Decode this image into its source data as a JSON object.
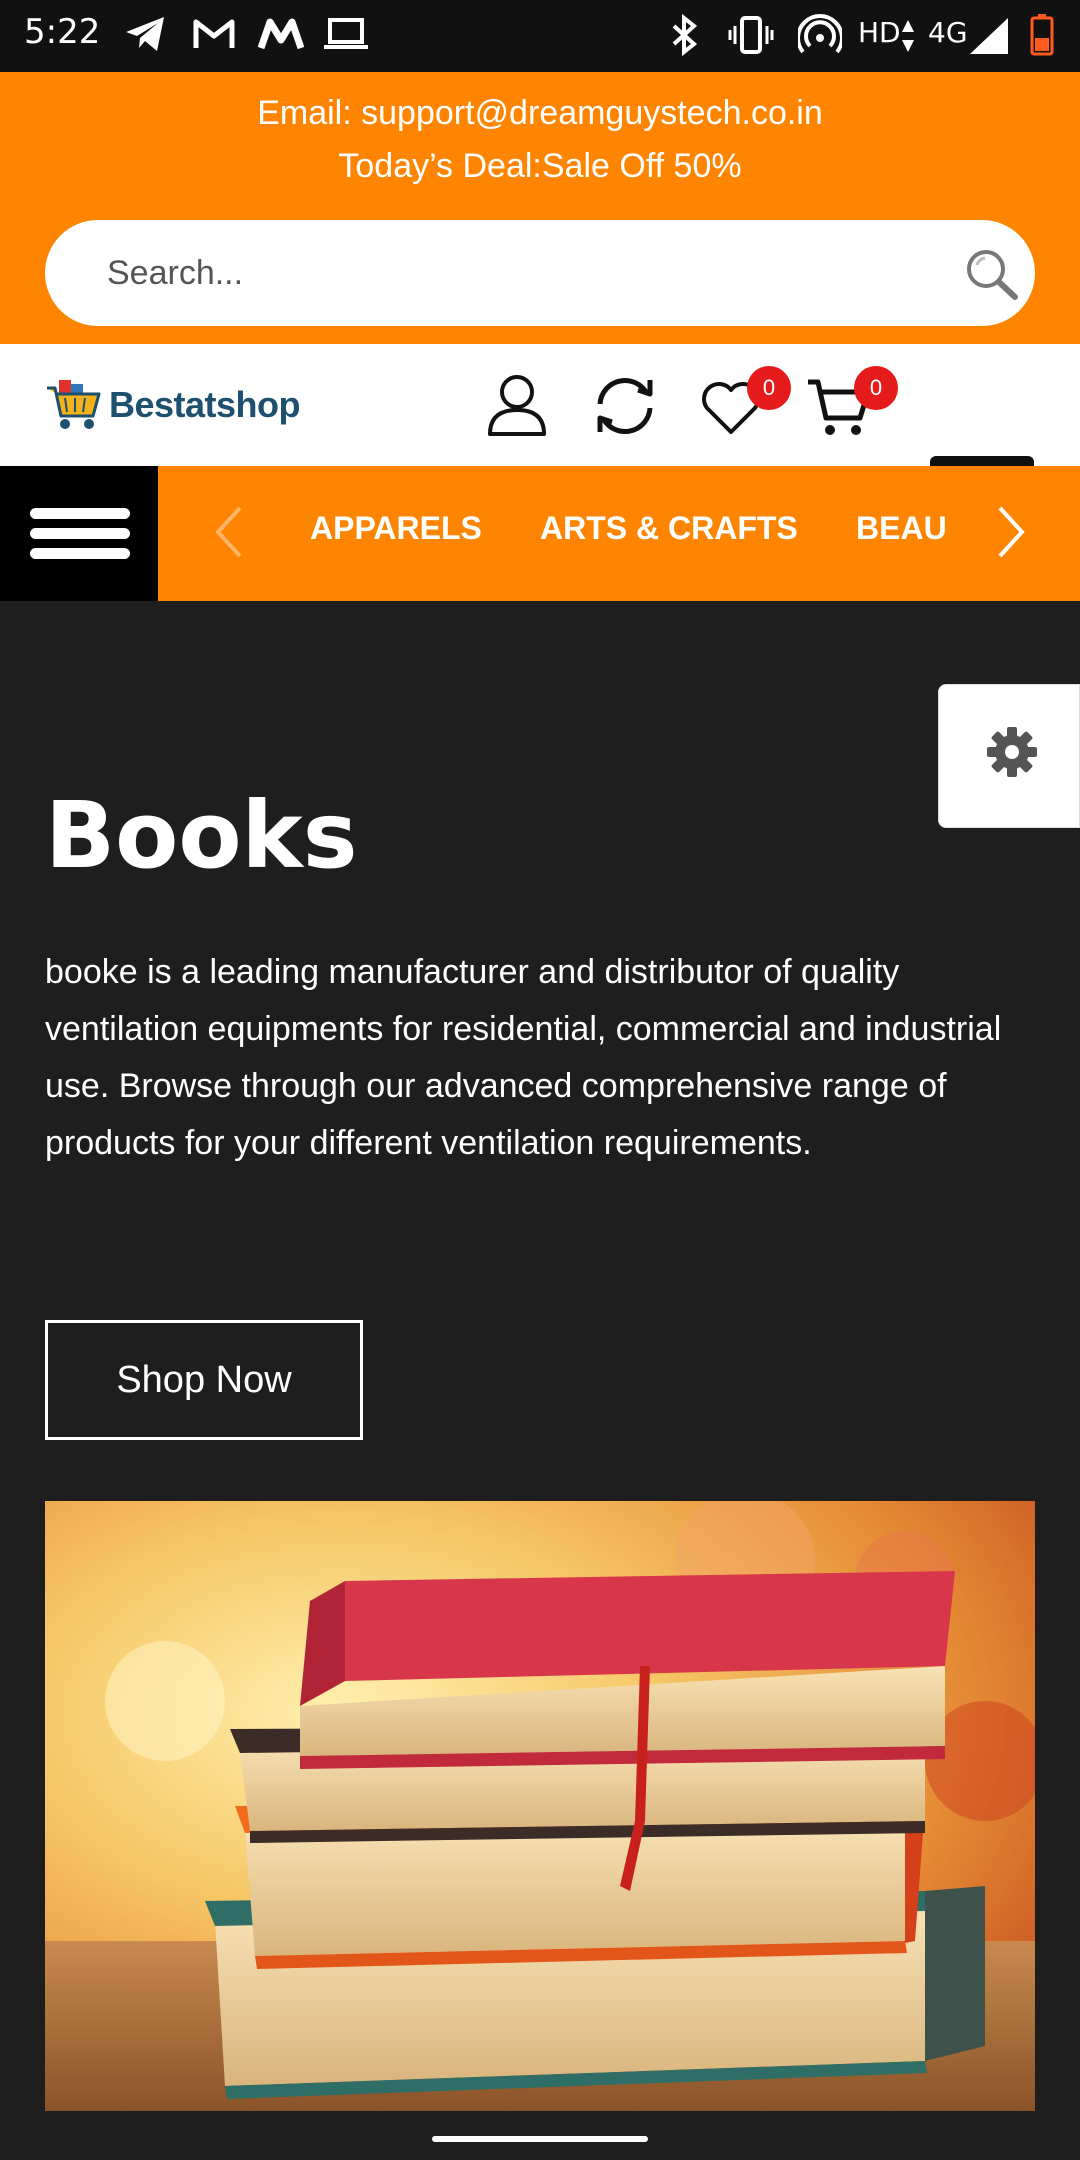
{
  "status_bar": {
    "time": "5:22",
    "network_label": "HD",
    "network_type": "4G",
    "icons": [
      "telegram-icon",
      "gmail-icon",
      "myntra-icon",
      "laptop-icon",
      "bluetooth-icon",
      "vibrate-icon",
      "hotspot-icon",
      "signal-icon",
      "battery-icon"
    ]
  },
  "topbar": {
    "email": "Email: support@dreamguystech.co.in",
    "deal": "Today’s Deal:Sale Off 50%",
    "accent_color": "#ff8500"
  },
  "search": {
    "placeholder": "Search..."
  },
  "header": {
    "logo_text": "Bestatshop",
    "wishlist_count": "0",
    "cart_count": "0"
  },
  "categories": {
    "items": [
      "APPARELS",
      "ARTS & CRAFTS",
      "BEAU"
    ]
  },
  "hero": {
    "title": "Books",
    "description": "booke is a leading manufacturer and distributor of quality ventilation equipments for residential, commercial and industrial use. Browse through our advanced comprehensive range of products for your different ventilation requirements.",
    "button_label": "Shop Now"
  }
}
